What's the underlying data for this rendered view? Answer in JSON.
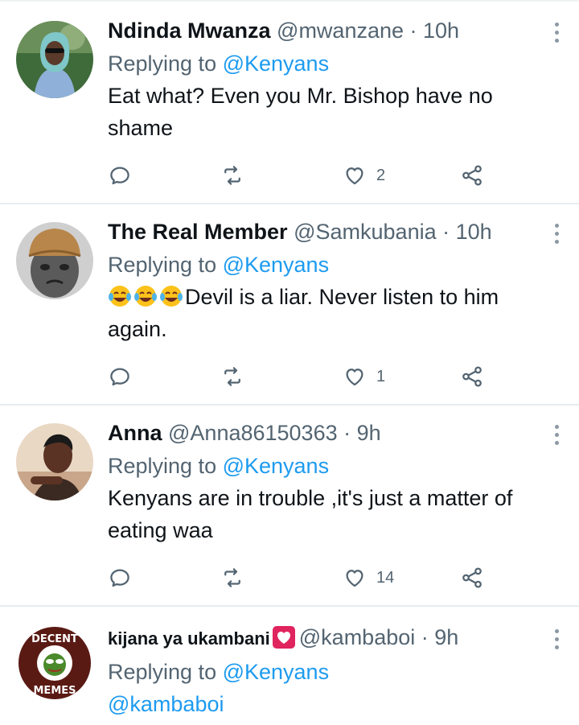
{
  "tweets": [
    {
      "name": "Ndinda Mwanza",
      "handle": "@mwanzane",
      "time": "· 10h",
      "replying_prefix": "Replying to ",
      "replying_to": "@Kenyans",
      "text": "Eat what? Even you Mr. Bishop have no shame",
      "like_count": "2",
      "avatar_icon": "woman-headscarf-avatar"
    },
    {
      "name": "The Real Member",
      "handle": "@Samkubania",
      "time": "· 10h",
      "replying_prefix": "Replying to ",
      "replying_to": "@Kenyans",
      "text": "Devil is a liar. Never listen to him again.",
      "emoji_prefix": "😂😂😂",
      "like_count": "1",
      "avatar_icon": "child-with-cap-avatar"
    },
    {
      "name": "Anna",
      "handle": "@Anna86150363",
      "time": "· 9h",
      "replying_prefix": "Replying to ",
      "replying_to": "@Kenyans",
      "text": "Kenyans are in trouble ,it's just a matter of eating waa",
      "like_count": "14",
      "avatar_icon": "woman-selfie-avatar"
    },
    {
      "name": "kijana ya ukambani",
      "name_badge_icon": "red-heart-emoji",
      "handle": "@kambaboi",
      "time": "· 9h",
      "replying_prefix": "Replying to ",
      "replying_to": "@Kenyans",
      "text": "@kambaboi",
      "avatar_icon": "decent-memes-logo-avatar",
      "avatar_text_top": "DECENT",
      "avatar_text_bottom": "MEMES"
    }
  ],
  "colors": {
    "link": "#1d9bf0",
    "secondary": "#536471",
    "divider": "#e6ecf0"
  }
}
